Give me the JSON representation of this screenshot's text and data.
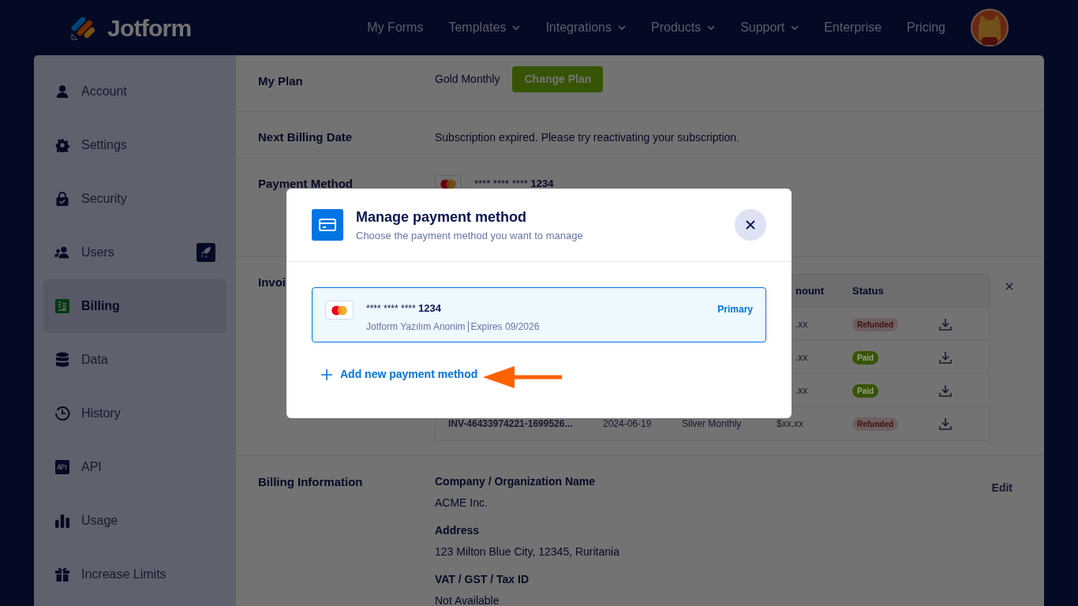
{
  "header": {
    "brand": "Jotform",
    "nav": [
      {
        "label": "My Forms",
        "dropdown": false
      },
      {
        "label": "Templates",
        "dropdown": true
      },
      {
        "label": "Integrations",
        "dropdown": true
      },
      {
        "label": "Products",
        "dropdown": true
      },
      {
        "label": "Support",
        "dropdown": true
      },
      {
        "label": "Enterprise",
        "dropdown": false
      },
      {
        "label": "Pricing",
        "dropdown": false
      }
    ]
  },
  "sidebar": {
    "items": [
      {
        "label": "Account",
        "kind": "user",
        "selected": false
      },
      {
        "label": "Settings",
        "kind": "gear",
        "selected": false
      },
      {
        "label": "Security",
        "kind": "lock",
        "selected": false
      },
      {
        "label": "Users",
        "kind": "users",
        "selected": false,
        "badge": true
      },
      {
        "label": "Billing",
        "kind": "billing",
        "selected": true
      },
      {
        "label": "Data",
        "kind": "database",
        "selected": false
      },
      {
        "label": "History",
        "kind": "history",
        "selected": false
      },
      {
        "label": "API",
        "kind": "api",
        "selected": false
      },
      {
        "label": "Usage",
        "kind": "chart",
        "selected": false
      },
      {
        "label": "Increase Limits",
        "kind": "gift",
        "selected": false
      }
    ]
  },
  "plan": {
    "label": "My Plan",
    "value": "Gold Monthly",
    "button": "Change Plan"
  },
  "next_billing": {
    "label": "Next Billing Date",
    "value": "Subscription expired. Please try reactivating your subscription."
  },
  "payment_method": {
    "label": "Payment Method",
    "masked": "**** **** ****",
    "last4": "1234"
  },
  "invoices": {
    "label": "Invoi",
    "columns": [
      "",
      "",
      "",
      "nount",
      "Status"
    ],
    "rows": [
      {
        "cells": [
          "",
          "",
          "",
          ".xx"
        ],
        "status": "Refunded",
        "color": "#6f5f5f"
      },
      {
        "cells": [
          "",
          "",
          "",
          ".xx"
        ],
        "status": "Paid",
        "color": "#365403"
      },
      {
        "cells": [
          "",
          "",
          "",
          ".xx"
        ],
        "status": "Paid",
        "color": "#365403"
      },
      {
        "cells": [
          "INV-46433974221-1699526...",
          "2024-06-19",
          "Silver Monthly",
          "$xx.xx"
        ],
        "status": "Refunded",
        "color": "#6f5f5f"
      }
    ]
  },
  "billing_info": {
    "label": "Billing Information",
    "edit": "Edit",
    "fields": [
      {
        "label": "Company / Organization Name",
        "value": "ACME Inc."
      },
      {
        "label": "Address",
        "value": "123 Milton Blue City, 12345, Ruritania"
      },
      {
        "label": "VAT / GST / Tax ID",
        "value": "Not Available"
      }
    ]
  },
  "modal": {
    "title": "Manage payment method",
    "subtitle": "Choose the payment method you want to manage",
    "cards": [
      {
        "masked": "**** **** ****",
        "last4": "1234",
        "holder": "Jotform Yazılım Anonim",
        "expires": "Expires 09/2026",
        "tag": "Primary",
        "selected": true
      }
    ],
    "add_link": "Add new payment method"
  }
}
